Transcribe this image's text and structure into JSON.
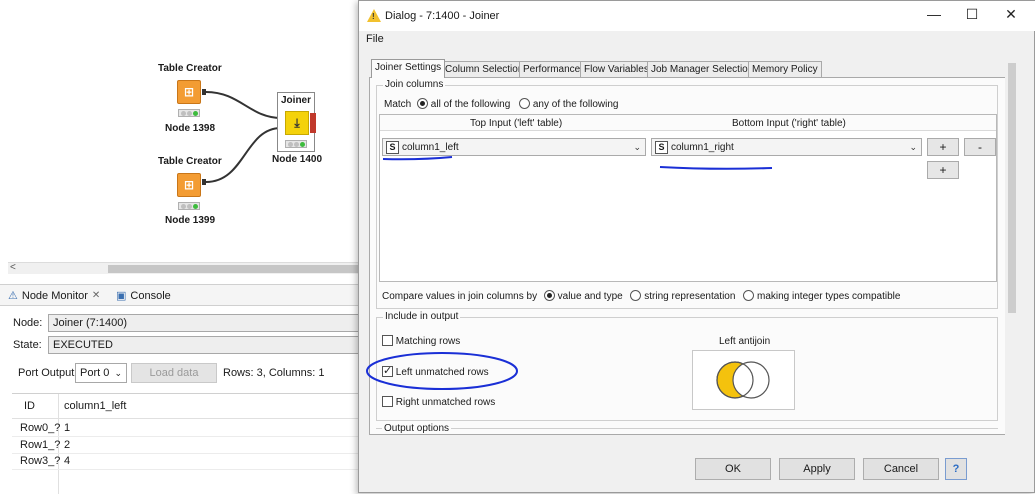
{
  "workflow": {
    "nodes": [
      {
        "title": "Table Creator",
        "label": "Node 1398",
        "icon": "table-icon"
      },
      {
        "title": "Table Creator",
        "label": "Node 1399",
        "icon": "table-icon"
      },
      {
        "title": "Joiner",
        "label": "Node 1400",
        "icon": "join-icon"
      }
    ]
  },
  "panel": {
    "tabs": [
      {
        "label": "Node Monitor",
        "icon": "monitor-icon"
      },
      {
        "label": "Console",
        "icon": "console-icon"
      }
    ],
    "node_label": "Node:",
    "node_value": "Joiner  (7:1400)",
    "state_label": "State:",
    "state_value": "EXECUTED",
    "port_output_label": "Port Output",
    "port_select": "Port 0",
    "load_data": "Load data",
    "rows_info": "Rows: 3, Columns: 1",
    "table": {
      "headers": [
        "ID",
        "column1_left"
      ],
      "rows": [
        [
          "Row0_?",
          "1"
        ],
        [
          "Row1_?",
          "2"
        ],
        [
          "Row3_?",
          "4"
        ]
      ]
    }
  },
  "dialog": {
    "title": "Dialog - 7:1400 - Joiner",
    "menu": [
      "File"
    ],
    "tabs": [
      "Joiner Settings",
      "Column Selection",
      "Performance",
      "Flow Variables",
      "Job Manager Selection",
      "Memory Policy"
    ],
    "join_columns": {
      "title": "Join columns",
      "match_label": "Match",
      "match_all": "all of the following",
      "match_any": "any of the following",
      "top_input_header": "Top Input ('left' table)",
      "bottom_input_header": "Bottom Input ('right' table)",
      "left_type": "S",
      "left_column": "column1_left",
      "right_type": "S",
      "right_column": "column1_right",
      "add_label": "+",
      "remove_label": "-",
      "compare_label": "Compare values in join columns by",
      "compare_value_type": "value and type",
      "compare_string": "string representation",
      "compare_integer": "making integer types compatible"
    },
    "include_output": {
      "title": "Include in output",
      "matching_rows": "Matching rows",
      "matching_checked": false,
      "left_unmatched": "Left unmatched rows",
      "left_checked": true,
      "right_unmatched": "Right unmatched rows",
      "right_checked": false,
      "venn_title": "Left antijoin"
    },
    "output_options_title": "Output options",
    "buttons": {
      "ok": "OK",
      "apply": "Apply",
      "cancel": "Cancel",
      "help": "?"
    }
  },
  "colors": {
    "node_orange": "#f39c33",
    "joiner_yellow": "#f4d20b",
    "venn_fill": "#f4c20d",
    "annotation_blue": "#1a2fd6"
  }
}
